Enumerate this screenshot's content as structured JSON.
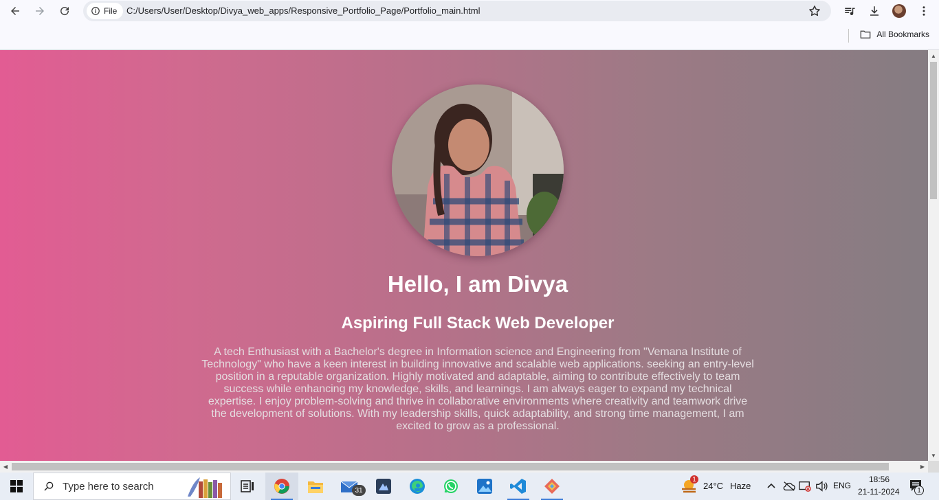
{
  "browser": {
    "site_chip_label": "File",
    "url": "C:/Users/User/Desktop/Divya_web_apps/Responsive_Portfolio_Page/Portfolio_main.html",
    "bookmarks_label": "All Bookmarks"
  },
  "page": {
    "name_heading": "Hello, I am Divya",
    "role_heading": "Aspiring Full Stack Web Developer",
    "bio": "A tech Enthusiast with a Bachelor's degree in Information science and Engineering from \"Vemana Institute of Technology\" who have a keen interest in building innovative and scalable web applications. seeking an entry-level position in a reputable organization. Highly motivated and adaptable, aiming to contribute effectively to team success while enhancing my knowledge, skills, and learnings. I am always eager to expand my technical expertise. I enjoy problem-solving and thrive in collaborative environments where creativity and teamwork drive the development of solutions. With my leadership skills, quick adaptability, and strong time management, I am excited to grow as a professional."
  },
  "taskbar": {
    "search_placeholder": "Type here to search",
    "mail_badge": "31",
    "weather_badge": "1",
    "temperature": "24°C",
    "weather": "Haze",
    "language": "ENG",
    "time": "18:56",
    "date": "21-11-2024",
    "notification_count": "1"
  },
  "colors": {
    "gradient_left": "#e25c93",
    "gradient_right": "#857c82",
    "taskbar": "#e8edf5"
  }
}
